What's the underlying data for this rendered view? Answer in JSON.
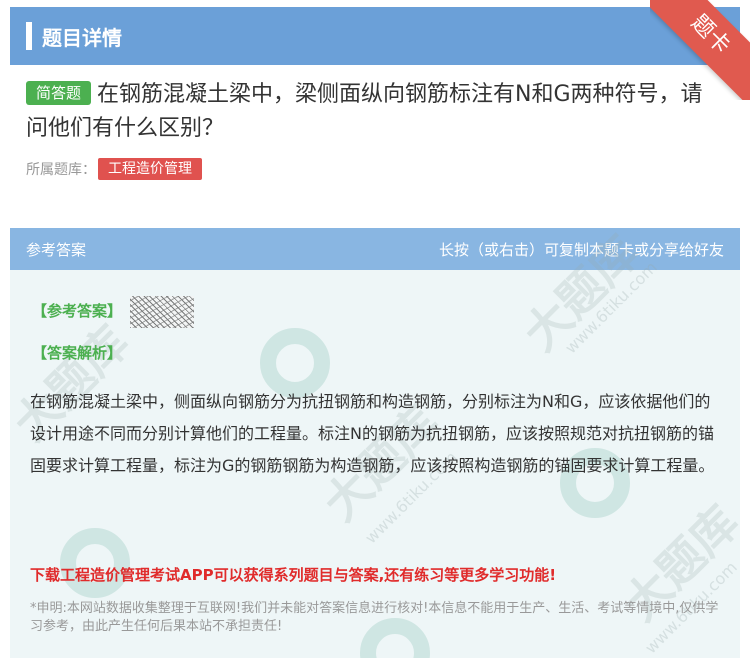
{
  "header": {
    "title": "题目详情",
    "ribbon_text": "题卡"
  },
  "question": {
    "type_badge": "简答题",
    "text": "在钢筋混凝土梁中，梁侧面纵向钢筋标注有N和G两种符号，请问他们有什么区别？",
    "library_label": "所属题库：",
    "library_name": "工程造价管理"
  },
  "answer_panel": {
    "title": "参考答案",
    "copy_hint": "长按（或右击）可复制本题卡或分享给好友",
    "reference_label": "【参考答案】",
    "analysis_label": "【答案解析】",
    "analysis_text": "在钢筋混凝土梁中，侧面纵向钢筋分为抗扭钢筋和构造钢筋，分别标注为N和G，应该依据他们的设计用途不同而分别计算他们的工程量。标注N的钢筋为抗扭钢筋，应该按照规范对抗扭钢筋的锚固要求计算工程量，标注为G的钢筋钢筋为构造钢筋，应该按照构造钢筋的锚固要求计算工程量。",
    "promo": "下载工程造价管理考试APP可以获得系列题目与答案,还有练习等更多学习功能!",
    "disclaimer": "*申明:本网站数据收集整理于互联网!我们并未能对答案信息进行核对!本信息不能用于生产、生活、考试等情境中,仅供学习参考，由此产生任何后果本站不承担责任!"
  },
  "colors": {
    "header_bg": "#6ba0d8",
    "answer_head_bg": "#89b6e2",
    "badge_green": "#4cb050",
    "badge_red": "#e0524f",
    "promo_red": "#e02b2b"
  }
}
